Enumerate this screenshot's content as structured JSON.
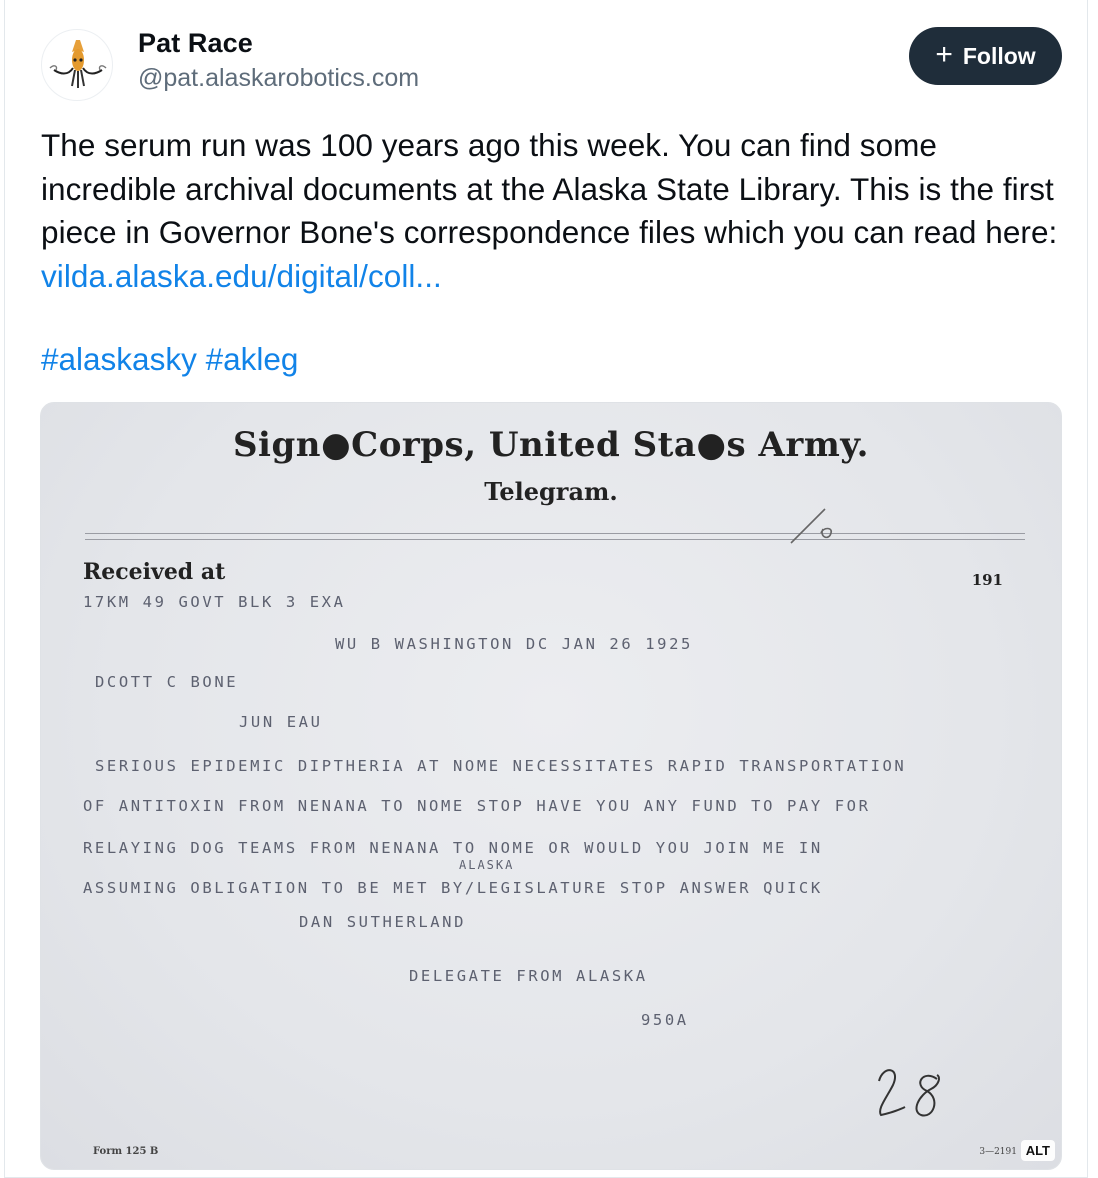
{
  "post": {
    "author_name": "Pat Race",
    "author_handle": "@pat.alaskarobotics.com",
    "follow_label": "Follow",
    "follow_icon": "plus-icon",
    "text_main": "The serum run was 100 years ago this week. You can find some incredible archival documents at the Alaska State Library. This is the first piece in Governor Bone's correspondence files which you can read here: ",
    "link_text": "vilda.alaska.edu/digital/coll...",
    "hashtags": [
      "#alaskasky",
      "#akleg"
    ]
  },
  "image": {
    "alt_badge": "ALT",
    "telegram": {
      "title": "Sign●Corps, United Sta●s Army.",
      "subtitle": "Telegram.",
      "received_at": "Received at",
      "number": "191",
      "handwritten_top": "16",
      "line1": "17KM 49 GOVT BLK 3 EXA",
      "line2": "WU B WASHINGTON DC JAN 26 1925",
      "line3": "DCOTT C BONE",
      "line4": "JUN EAU",
      "line5": "SERIOUS EPIDEMIC DIPTHERIA AT NOME NECESSITATES RAPID TRANSPORTATION",
      "line6": "OF ANTITOXIN FROM NENANA TO NOME STOP HAVE YOU ANY FUND TO PAY FOR",
      "line7": "RELAYING DOG TEAMS FROM NENANA TO NOME OR WOULD YOU JOIN ME IN",
      "line7b": "ALASKA",
      "line8": "ASSUMING OBLIGATION TO BE MET BY/LEGISLATURE STOP ANSWER QUICK",
      "line9": "DAN SUTHERLAND",
      "line10": "DELEGATE FROM ALASKA",
      "line11": "950A",
      "handwritten_bottom": "28",
      "form": "Form 125 B",
      "code": "3—2191"
    }
  },
  "colors": {
    "link": "#1183e8",
    "follow_bg": "#1f2d3a",
    "handle": "#5e6c7a"
  }
}
